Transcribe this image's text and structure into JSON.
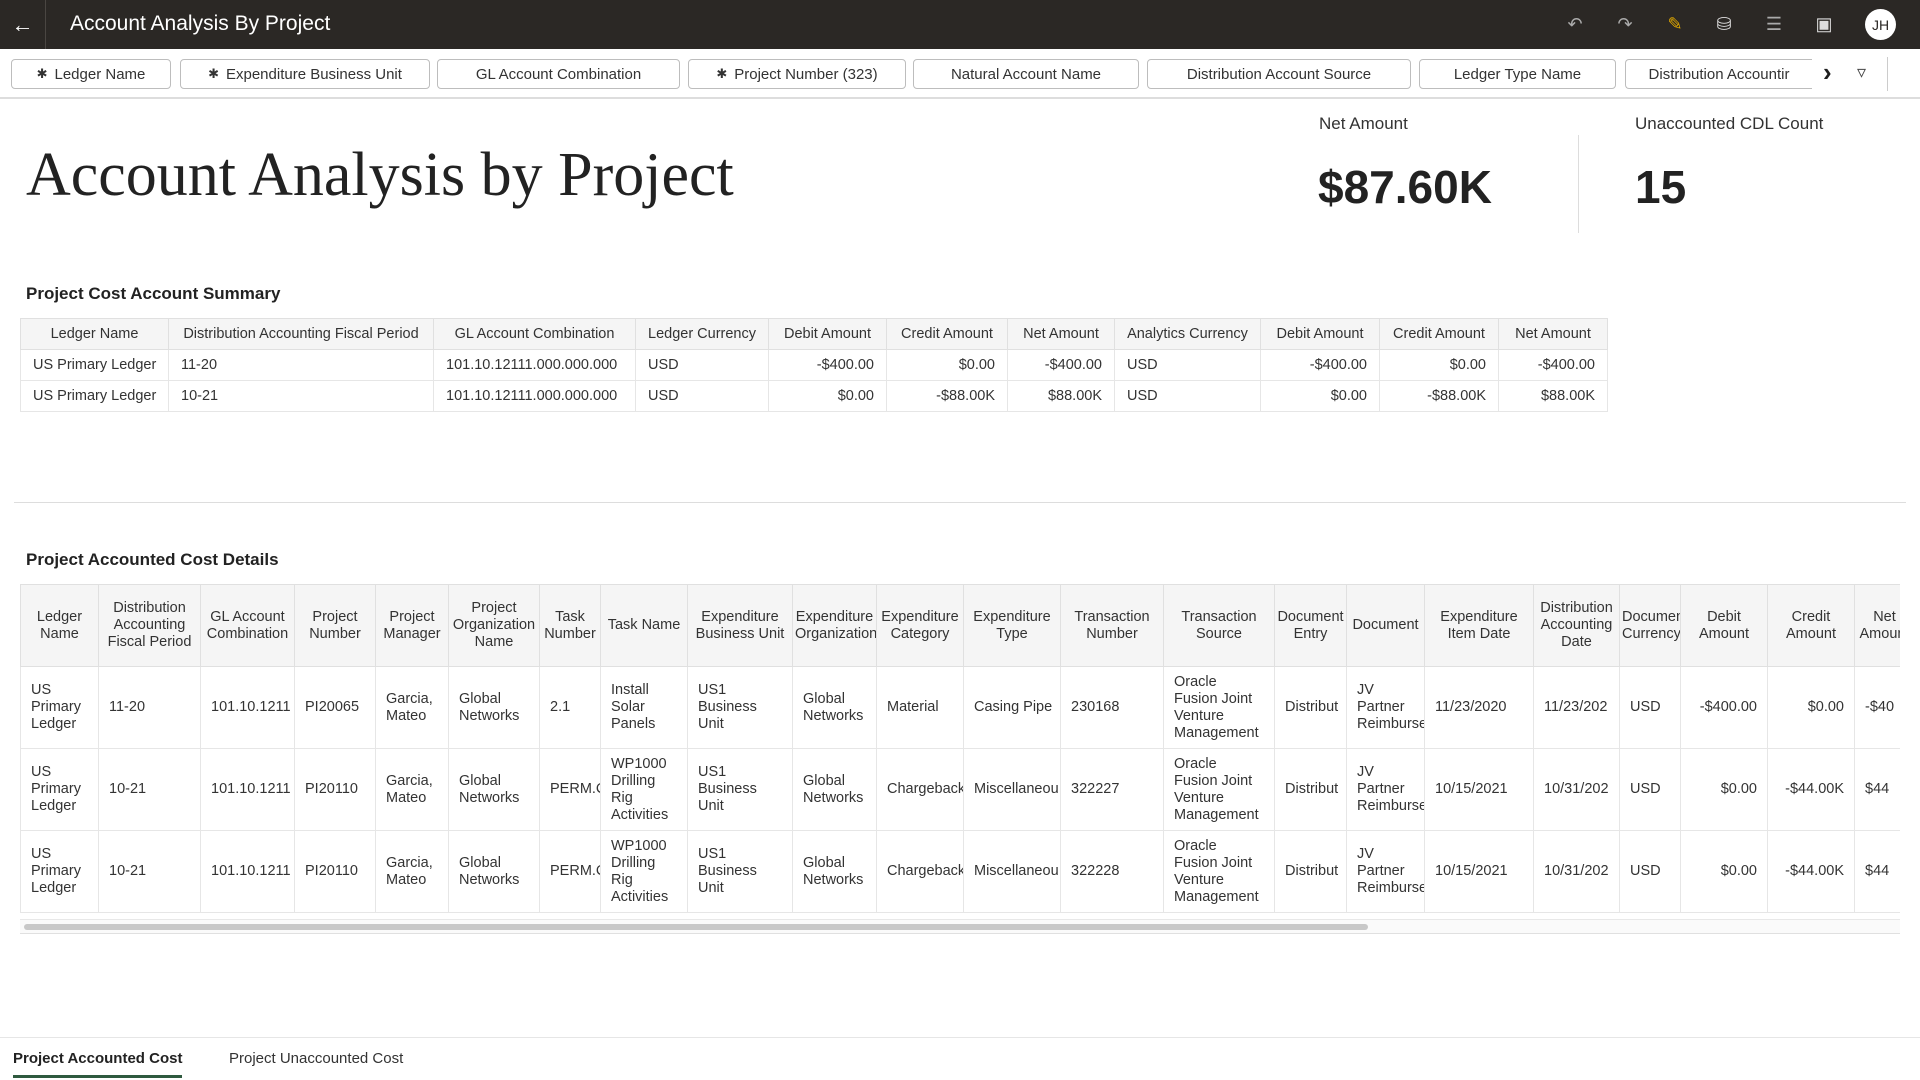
{
  "header": {
    "title": "Account Analysis By Project",
    "avatar": "JH",
    "icons": [
      "back-arrow-icon",
      "undo-icon",
      "redo-icon",
      "edit-icon",
      "data-refresh-icon",
      "comment-icon",
      "present-icon"
    ],
    "accent": "#e0a800"
  },
  "filters": [
    {
      "label": "Ledger Name",
      "pinned": true
    },
    {
      "label": "Expenditure Business Unit",
      "pinned": true
    },
    {
      "label": "GL Account Combination",
      "pinned": false
    },
    {
      "label": "Project Number (323)",
      "pinned": true
    },
    {
      "label": "Natural Account Name",
      "pinned": false
    },
    {
      "label": "Distribution Account Source",
      "pinned": false
    },
    {
      "label": "Ledger Type Name",
      "pinned": false
    },
    {
      "label": "Distribution Accountir",
      "pinned": false
    }
  ],
  "page": {
    "title": "Account Analysis by Project"
  },
  "kpis": [
    {
      "label": "Net Amount",
      "value": "$87.60K"
    },
    {
      "label": "Unaccounted CDL Count",
      "value": "15"
    }
  ],
  "summary": {
    "title": "Project Cost Account Summary",
    "columns": [
      "Ledger Name",
      "Distribution Accounting Fiscal Period",
      "GL Account Combination",
      "Ledger Currency",
      "Debit Amount",
      "Credit Amount",
      "Net Amount",
      "Analytics Currency",
      "Debit Amount",
      "Credit Amount",
      "Net Amount"
    ],
    "rows": [
      [
        "US Primary Ledger",
        "11-20",
        "101.10.12111.000.000.000",
        "USD",
        "-$400.00",
        "$0.00",
        "-$400.00",
        "USD",
        "-$400.00",
        "$0.00",
        "-$400.00"
      ],
      [
        "US Primary Ledger",
        "10-21",
        "101.10.12111.000.000.000",
        "USD",
        "$0.00",
        "-$88.00K",
        "$88.00K",
        "USD",
        "$0.00",
        "-$88.00K",
        "$88.00K"
      ]
    ]
  },
  "details": {
    "title": "Project Accounted Cost Details",
    "columns": [
      "Ledger Name",
      "Distribution Accounting Fiscal Period",
      "GL Account Combination",
      "Project Number",
      "Project Manager",
      "Project Organization Name",
      "Task Number",
      "Task Name",
      "Expenditure Business Unit",
      "Expenditure Organization",
      "Expenditure Category",
      "Expenditure Type",
      "Transaction Number",
      "Transaction Source",
      "Document Entry",
      "Document",
      "Expenditure Item Date",
      "Distribution Accounting Date",
      "Document Currency",
      "Debit Amount",
      "Credit Amount",
      "Net Amount"
    ],
    "rows": [
      [
        "US Primary Ledger",
        "11-20",
        "101.10.1211",
        "PI20065",
        "Garcia, Mateo",
        "Global Networks",
        "2.1",
        "Install Solar Panels",
        "US1 Business Unit",
        "Global Networks",
        "Material",
        "Casing Pipe",
        "230168",
        "Oracle Fusion Joint Venture Management",
        "Distribut",
        "JV Partner Reimburse",
        "11/23/2020",
        "11/23/202",
        "USD",
        "-$400.00",
        "$0.00",
        "-$40"
      ],
      [
        "US Primary Ledger",
        "10-21",
        "101.10.1211",
        "PI20110",
        "Garcia, Mateo",
        "Global Networks",
        "PERM.C",
        "WP1000 Drilling Rig Activities",
        "US1 Business Unit",
        "Global Networks",
        "Chargeback",
        "Miscellaneou",
        "322227",
        "Oracle Fusion Joint Venture Management",
        "Distribut",
        "JV Partner Reimburse",
        "10/15/2021",
        "10/31/202",
        "USD",
        "$0.00",
        "-$44.00K",
        "$44"
      ],
      [
        "US Primary Ledger",
        "10-21",
        "101.10.1211",
        "PI20110",
        "Garcia, Mateo",
        "Global Networks",
        "PERM.C",
        "WP1000 Drilling Rig Activities",
        "US1 Business Unit",
        "Global Networks",
        "Chargeback",
        "Miscellaneou",
        "322228",
        "Oracle Fusion Joint Venture Management",
        "Distribut",
        "JV Partner Reimburse",
        "10/15/2021",
        "10/31/202",
        "USD",
        "$0.00",
        "-$44.00K",
        "$44"
      ]
    ]
  },
  "tabs": [
    {
      "label": "Project Accounted Cost",
      "active": true
    },
    {
      "label": "Project Unaccounted Cost",
      "active": false
    }
  ]
}
